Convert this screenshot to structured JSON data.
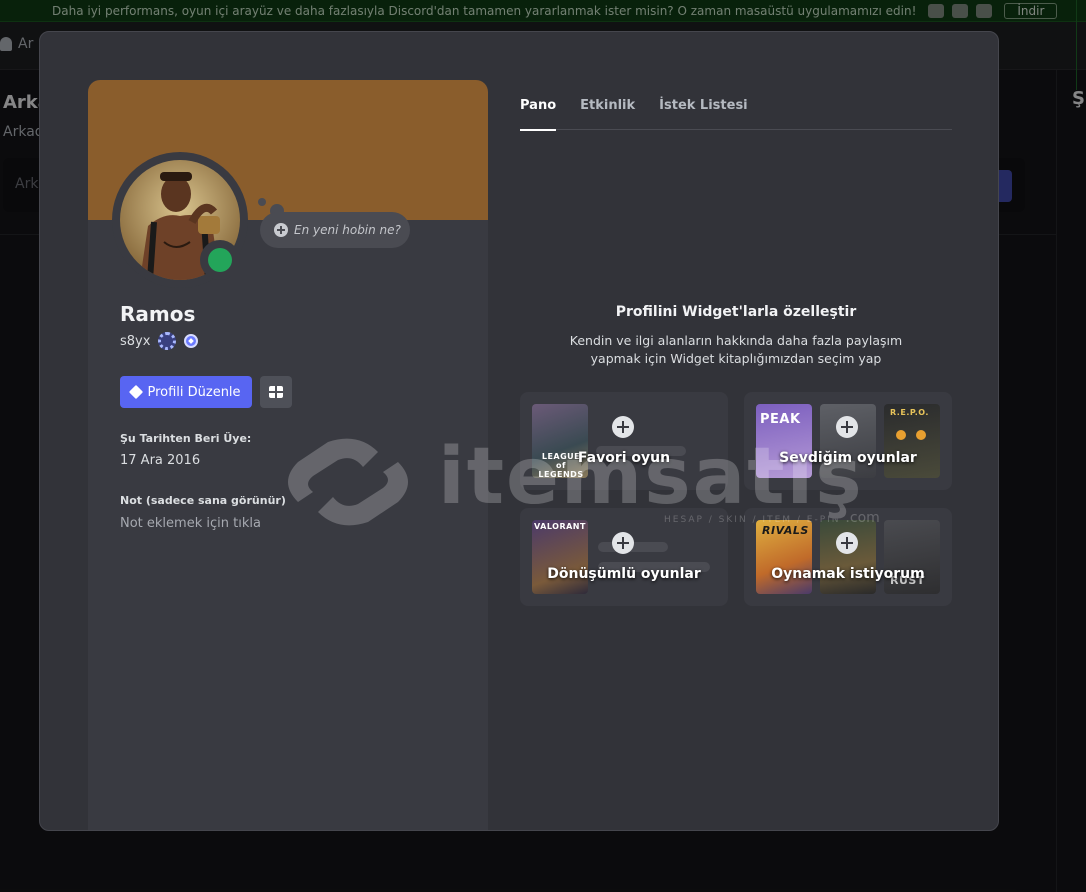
{
  "app_banner": {
    "promo_text": "Daha iyi performans, oyun içi arayüz ve daha fazlasıyla Discord'dan tamamen yararlanmak ister misin? O zaman masaüstü uygulamamızı edin!",
    "download_label": "İndir",
    "platform_icons": [
      "apple-icon",
      "android-icon",
      "windows-icon"
    ]
  },
  "background": {
    "friends_tab": "Ar",
    "title": "Arka",
    "subtitle": "Arkad",
    "search_placeholder": "Ark",
    "right_title": "Şi"
  },
  "profile": {
    "display_name": "Ramos",
    "username": "s8yx",
    "hobby_placeholder": "En yeni hobin ne?",
    "edit_button": "Profili Düzenle",
    "member_since_label": "Şu Tarihten Beri Üye:",
    "member_since_value": "17 Ara 2016",
    "note_label": "Not (sadece sana görünür)",
    "note_placeholder": "Not eklemek için tıkla",
    "banner_color": "#8a5d2c",
    "status_color": "#23a55a"
  },
  "tabs": [
    {
      "label": "Pano",
      "active": true
    },
    {
      "label": "Etkinlik",
      "active": false
    },
    {
      "label": "İstek Listesi",
      "active": false
    }
  ],
  "widgets_intro": {
    "title": "Profilini Widget'larla özelleştir",
    "description": "Kendin ve ilgi alanların hakkında daha fazla paylaşım yapmak için Widget kitaplığımızdan seçim yap"
  },
  "widgets": [
    {
      "label": "Favori oyun",
      "thumbs": [
        "LEAGUE of LEGENDS"
      ]
    },
    {
      "label": "Sevdiğim oyunlar",
      "thumbs": [
        "PEAK",
        "",
        "R.E.P.O."
      ]
    },
    {
      "label": "Dönüşümlü oyunlar",
      "thumbs": [
        "VALORANT"
      ]
    },
    {
      "label": "Oynamak istiyorum",
      "thumbs": [
        "RIVALS",
        "",
        "RUST"
      ]
    }
  ],
  "watermark": {
    "text": "itemsatış",
    "sub": "HESAP / SKIN / ITEM / E-PIN",
    "suffix": ".com"
  }
}
